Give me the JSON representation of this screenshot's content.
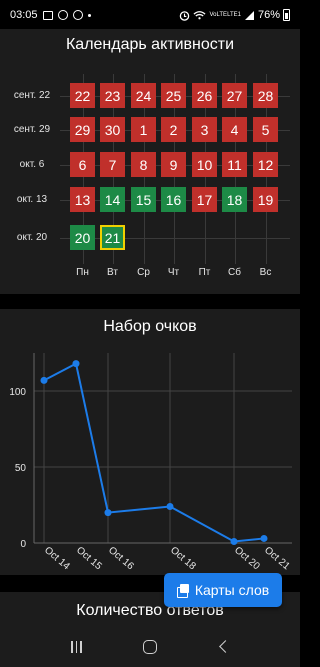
{
  "status_bar": {
    "time": "03:05",
    "network": "VoLTE",
    "signal": "LTE1",
    "battery": "76%"
  },
  "calendar": {
    "title": "Календарь активности",
    "rows": [
      {
        "label": "сент. 22",
        "days": [
          {
            "n": "22",
            "s": "red"
          },
          {
            "n": "23",
            "s": "red"
          },
          {
            "n": "24",
            "s": "red"
          },
          {
            "n": "25",
            "s": "red"
          },
          {
            "n": "26",
            "s": "red"
          },
          {
            "n": "27",
            "s": "red"
          },
          {
            "n": "28",
            "s": "red"
          }
        ]
      },
      {
        "label": "сент. 29",
        "days": [
          {
            "n": "29",
            "s": "red"
          },
          {
            "n": "30",
            "s": "red"
          },
          {
            "n": "1",
            "s": "red"
          },
          {
            "n": "2",
            "s": "red"
          },
          {
            "n": "3",
            "s": "red"
          },
          {
            "n": "4",
            "s": "red"
          },
          {
            "n": "5",
            "s": "red"
          }
        ]
      },
      {
        "label": "окт. 6",
        "days": [
          {
            "n": "6",
            "s": "red"
          },
          {
            "n": "7",
            "s": "red"
          },
          {
            "n": "8",
            "s": "red"
          },
          {
            "n": "9",
            "s": "red"
          },
          {
            "n": "10",
            "s": "red"
          },
          {
            "n": "11",
            "s": "red"
          },
          {
            "n": "12",
            "s": "red"
          }
        ]
      },
      {
        "label": "окт. 13",
        "days": [
          {
            "n": "13",
            "s": "red"
          },
          {
            "n": "14",
            "s": "green"
          },
          {
            "n": "15",
            "s": "green"
          },
          {
            "n": "16",
            "s": "green"
          },
          {
            "n": "17",
            "s": "red"
          },
          {
            "n": "18",
            "s": "green"
          },
          {
            "n": "19",
            "s": "red"
          }
        ]
      },
      {
        "label": "окт. 20",
        "days": [
          {
            "n": "20",
            "s": "green"
          },
          {
            "n": "21",
            "s": "green",
            "today": true
          }
        ]
      }
    ],
    "weekdays": [
      "Пн",
      "Вт",
      "Ср",
      "Чт",
      "Пт",
      "Сб",
      "Вс"
    ],
    "colors": {
      "inactive": "#c0302b",
      "active": "#1d8a46",
      "today_border": "#f0d000"
    }
  },
  "points_chart": {
    "title": "Набор очков"
  },
  "chart_data": {
    "type": "line",
    "title": "Набор очков",
    "x": [
      "Oct 14",
      "Oct 15",
      "Oct 16",
      "Oct 18",
      "Oct 20",
      "Oct 21"
    ],
    "series": [
      {
        "values": [
          107,
          118,
          20,
          24,
          1,
          3
        ],
        "color": "#1c7ce9"
      }
    ],
    "ylim": [
      0,
      125
    ],
    "yticks": [
      0,
      50,
      100
    ],
    "grid": true
  },
  "answers_card": {
    "title": "Количество ответов"
  },
  "fab": {
    "label": "Карты слов",
    "icon": "cards-icon"
  },
  "nav": {
    "recents": "recents-icon",
    "home": "home-icon",
    "back": "back-icon"
  }
}
